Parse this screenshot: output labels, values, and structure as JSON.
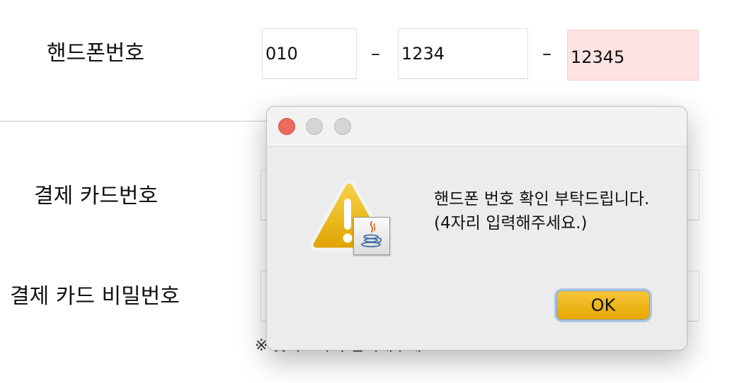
{
  "form": {
    "phone_label": "핸드폰번호",
    "phone_part1": "010",
    "phone_part2": "1234",
    "phone_part3": "12345",
    "dash": "–",
    "card_number_label": "결제 카드번호",
    "card_password_label": "결제 카드 비밀번호",
    "note": "※ 숫자 4자리 입력해주세요."
  },
  "dialog": {
    "message_line1": "핸드폰 번호 확인 부탁드립니다.",
    "message_line2": "(4자리 입력해주세요.)",
    "ok_label": "OK",
    "icon": "warning-java-icon"
  },
  "colors": {
    "error_field": "#fde3e1",
    "ok_button": "#f0b400",
    "close_light": "#ee6a5f"
  }
}
